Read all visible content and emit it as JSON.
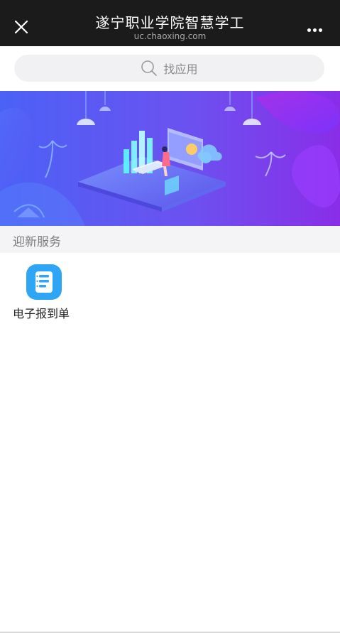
{
  "header": {
    "title": "遂宁职业学院智慧学工",
    "subtitle": "uc.chaoxing.com",
    "close_icon": "close-icon",
    "more_icon": "more-icon"
  },
  "search": {
    "placeholder": "找应用",
    "icon": "search-icon"
  },
  "banner": {
    "theme_colors": [
      "#4c5cf3",
      "#7a2fe8",
      "#5a88ff"
    ]
  },
  "section": {
    "title": "迎新服务"
  },
  "apps": [
    {
      "label": "电子报到单",
      "icon": "registration-form-icon",
      "color": "#2ea5f5"
    }
  ]
}
